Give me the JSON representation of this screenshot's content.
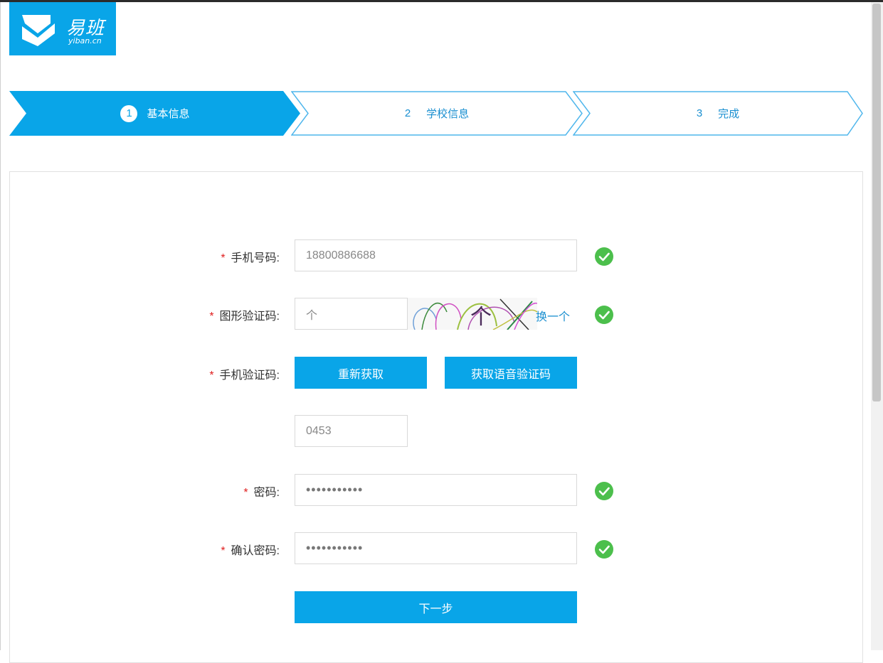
{
  "logo": {
    "main_text": "易班",
    "sub_text": "yiban.cn",
    "brand_color": "#09a5e8"
  },
  "steps": [
    {
      "num": "1",
      "label": "基本信息",
      "active": true
    },
    {
      "num": "2",
      "label": "学校信息",
      "active": false
    },
    {
      "num": "3",
      "label": "完成",
      "active": false
    }
  ],
  "form": {
    "required_mark": "*",
    "phone": {
      "label": "手机号码:",
      "value": "18800886688",
      "valid": true
    },
    "captcha": {
      "label": "图形验证码:",
      "value": "个",
      "image_char": "个",
      "change_label": "换一个",
      "valid": true
    },
    "sms": {
      "label": "手机验证码:",
      "resend_label": "重新获取",
      "voice_label": "获取语音验证码",
      "value": "0453"
    },
    "password": {
      "label": "密码:",
      "value": "•••••••••••",
      "valid": true
    },
    "confirm": {
      "label": "确认密码:",
      "value": "•••••••••••",
      "valid": true
    },
    "next_label": "下一步"
  },
  "colors": {
    "accent": "#09a5e8",
    "success": "#4cbf4c",
    "required": "#e02020"
  }
}
